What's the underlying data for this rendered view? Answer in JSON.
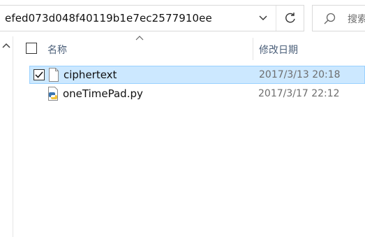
{
  "address_bar": {
    "path": "efed073d048f40119b1e7ec2577910ee",
    "dropdown_icon": "chevron-down-icon",
    "refresh_icon": "refresh-icon"
  },
  "search": {
    "placeholder": "搜索",
    "icon": "search-icon"
  },
  "nav_pane": {
    "collapse_icon": "chevron-up-icon"
  },
  "columns": {
    "name": "名称",
    "date_modified": "修改日期",
    "sort_icon": "sort-ascending-icon"
  },
  "files": [
    {
      "name": "ciphertext",
      "date": "2017/3/13 20:18",
      "icon": "document-icon",
      "selected": true,
      "checked": true
    },
    {
      "name": "oneTimePad.py",
      "date": "2017/3/17 22:12",
      "icon": "python-file-icon",
      "selected": false,
      "checked": false
    }
  ],
  "colors": {
    "selection_bg": "#cce8ff",
    "selection_border": "#99d1ff",
    "header_text": "#4c607a"
  }
}
